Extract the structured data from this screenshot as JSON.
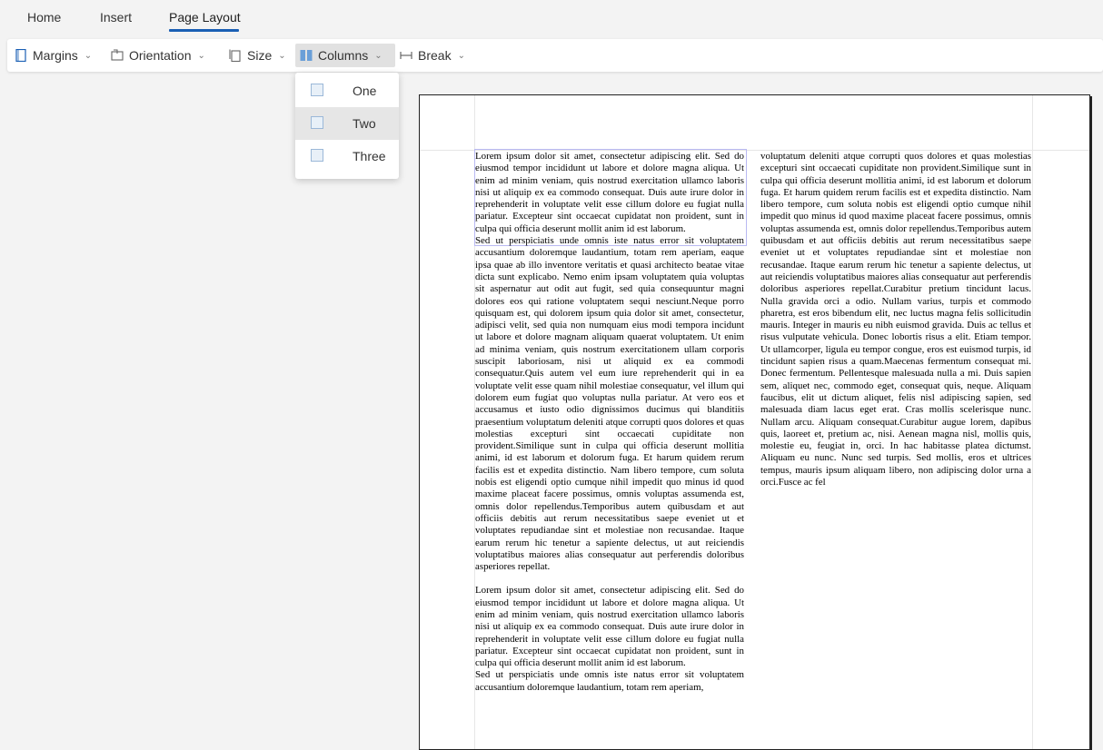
{
  "tabs": [
    {
      "label": "Home"
    },
    {
      "label": "Insert"
    },
    {
      "label": "Page Layout"
    }
  ],
  "toolbar": {
    "margins": "Margins",
    "orientation": "Orientation",
    "size": "Size",
    "columns": "Columns",
    "break": "Break"
  },
  "columns_menu": [
    {
      "label": "One"
    },
    {
      "label": "Two"
    },
    {
      "label": "Three"
    }
  ],
  "document": {
    "col1": [
      "Lorem ipsum dolor sit amet, consectetur adipiscing elit. Sed do eiusmod tempor incididunt ut labore et dolore magna aliqua. Ut enim ad minim veniam, quis nostrud exercitation ullamco laboris nisi ut aliquip ex ea commodo consequat. Duis aute irure dolor in reprehenderit in voluptate velit esse cillum dolore eu fugiat nulla pariatur. Excepteur sint occaecat cupidatat non proident, sunt in culpa qui officia deserunt mollit anim id est laborum.",
      "Sed ut perspiciatis unde omnis iste natus error sit voluptatem accusantium doloremque laudantium, totam rem aperiam, eaque ipsa quae ab illo inventore veritatis et quasi architecto beatae vitae dicta sunt explicabo. Nemo enim ipsam voluptatem quia voluptas sit aspernatur aut odit aut fugit, sed quia consequuntur magni dolores eos qui ratione voluptatem sequi nesciunt.Neque porro quisquam est, qui dolorem ipsum quia dolor sit amet, consectetur, adipisci velit, sed quia non numquam eius modi tempora incidunt ut labore et dolore magnam aliquam quaerat voluptatem. Ut enim ad minima veniam, quis nostrum exercitationem ullam corporis suscipit laboriosam, nisi ut aliquid ex ea commodi consequatur.Quis autem vel eum iure reprehenderit qui in ea voluptate velit esse quam nihil molestiae consequatur, vel illum qui dolorem eum fugiat quo voluptas nulla pariatur. At vero eos et accusamus et iusto odio dignissimos ducimus qui blanditiis praesentium voluptatum deleniti atque corrupti quos dolores et quas molestias excepturi sint occaecati cupiditate non provident.Similique sunt in culpa qui officia deserunt mollitia animi, id est laborum et dolorum fuga. Et harum quidem rerum facilis est et expedita distinctio. Nam libero tempore, cum soluta nobis est eligendi optio cumque nihil impedit quo minus id quod maxime placeat facere possimus, omnis voluptas assumenda est, omnis dolor repellendus.Temporibus autem quibusdam et aut officiis debitis aut rerum necessitatibus saepe eveniet ut et voluptates repudiandae sint et molestiae non recusandae. Itaque earum rerum hic tenetur a sapiente delectus, ut aut reiciendis voluptatibus maiores alias consequatur aut perferendis doloribus asperiores repellat.",
      "Lorem ipsum dolor sit amet, consectetur adipiscing elit. Sed do eiusmod tempor incididunt ut labore et dolore magna aliqua. Ut enim ad minim veniam, quis nostrud exercitation ullamco laboris nisi ut aliquip ex ea commodo consequat. Duis aute irure dolor in reprehenderit in voluptate velit esse cillum dolore eu fugiat nulla pariatur. Excepteur sint occaecat cupidatat non proident, sunt in culpa qui officia deserunt mollit anim id est laborum.",
      "Sed ut perspiciatis unde omnis iste natus error sit voluptatem accusantium doloremque laudantium, totam rem aperiam,"
    ],
    "col2": [
      "voluptatum deleniti atque corrupti quos dolores et quas molestias excepturi sint occaecati cupiditate non provident.Similique sunt in culpa qui officia deserunt mollitia animi, id est laborum et dolorum fuga. Et harum quidem rerum facilis est et expedita distinctio. Nam libero tempore, cum soluta nobis est eligendi optio cumque nihil impedit quo minus id quod maxime placeat facere possimus, omnis voluptas assumenda est, omnis dolor repellendus.Temporibus autem quibusdam et aut officiis debitis aut rerum necessitatibus saepe eveniet ut et voluptates repudiandae sint et molestiae non recusandae. Itaque earum rerum hic tenetur a sapiente delectus, ut aut reiciendis voluptatibus maiores alias consequatur aut perferendis doloribus asperiores repellat.Curabitur pretium tincidunt lacus. Nulla gravida orci a odio. Nullam varius, turpis et commodo pharetra, est eros bibendum elit, nec luctus magna felis sollicitudin mauris. Integer in mauris eu nibh euismod gravida. Duis ac tellus et risus vulputate vehicula. Donec lobortis risus a elit. Etiam tempor. Ut ullamcorper, ligula eu tempor congue, eros est euismod turpis, id tincidunt sapien risus a quam.Maecenas fermentum consequat mi. Donec fermentum. Pellentesque malesuada nulla a mi. Duis sapien sem, aliquet nec, commodo eget, consequat quis, neque. Aliquam faucibus, elit ut dictum aliquet, felis nisl adipiscing sapien, sed malesuada diam lacus eget erat. Cras mollis scelerisque nunc. Nullam arcu. Aliquam consequat.Curabitur augue lorem, dapibus quis, laoreet et, pretium ac, nisi. Aenean magna nisl, mollis quis, molestie eu, feugiat in, orci. In hac habitasse platea dictumst. Aliquam eu nunc. Nunc sed turpis. Sed mollis, eros et ultrices tempus, mauris ipsum aliquam libero, non adipiscing dolor urna a orci.Fusce ac fel"
    ]
  }
}
